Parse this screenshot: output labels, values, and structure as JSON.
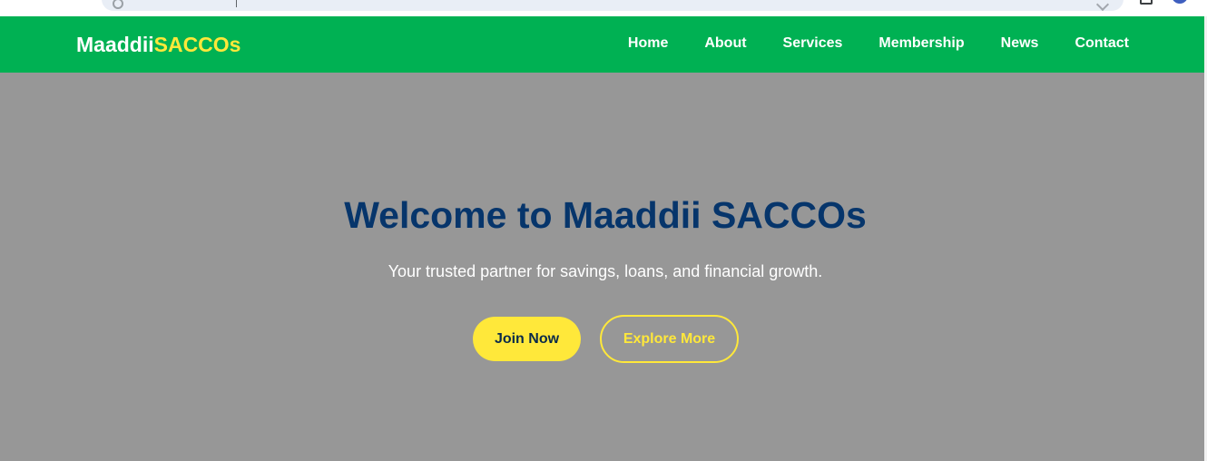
{
  "brand": {
    "name_main": "Maaddii",
    "name_accent": "SACCOs"
  },
  "nav": {
    "items": [
      {
        "label": "Home"
      },
      {
        "label": "About"
      },
      {
        "label": "Services"
      },
      {
        "label": "Membership"
      },
      {
        "label": "News"
      },
      {
        "label": "Contact"
      }
    ]
  },
  "hero": {
    "title": "Welcome to Maaddii SACCOs",
    "subtitle": "Your trusted partner for savings, loans, and financial growth.",
    "primary_button": "Join Now",
    "secondary_button": "Explore More"
  },
  "colors": {
    "navbar_bg": "#00b153",
    "brand_accent": "#ffe83a",
    "hero_bg": "#979797",
    "title_color": "#06356b"
  }
}
